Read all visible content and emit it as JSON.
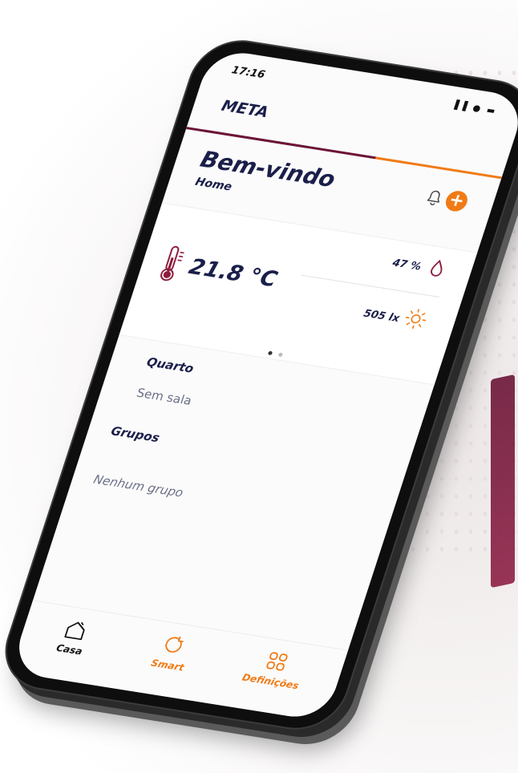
{
  "status_bar": {
    "time": "17:16",
    "indicators": "▐▐ ● ▬"
  },
  "app": {
    "title": "META"
  },
  "header": {
    "welcome": "Bem-vindo",
    "home_name": "Home",
    "bell_icon": "bell-icon",
    "add_icon": "plus-circle-icon",
    "add_label": "+"
  },
  "climate": {
    "temperature": "21.8 °C",
    "humidity": "47 %",
    "illuminance": "505 lx"
  },
  "pager": {
    "pages": 2,
    "active": 0
  },
  "sections": {
    "rooms_title": "Quarto",
    "rooms_empty": "Sem sala",
    "groups_title": "Grupos",
    "groups_empty": "Nenhum grupo"
  },
  "tabbar": {
    "tabs": [
      {
        "label": "Casa",
        "icon": "home-icon",
        "active": true
      },
      {
        "label": "Smart",
        "icon": "smart-icon",
        "active": false
      },
      {
        "label": "Definições",
        "icon": "grid-icon",
        "active": false
      }
    ]
  },
  "colors": {
    "brand_primary": "#6b1536",
    "brand_accent": "#f07b16",
    "text_dark": "#1a1f4a"
  }
}
